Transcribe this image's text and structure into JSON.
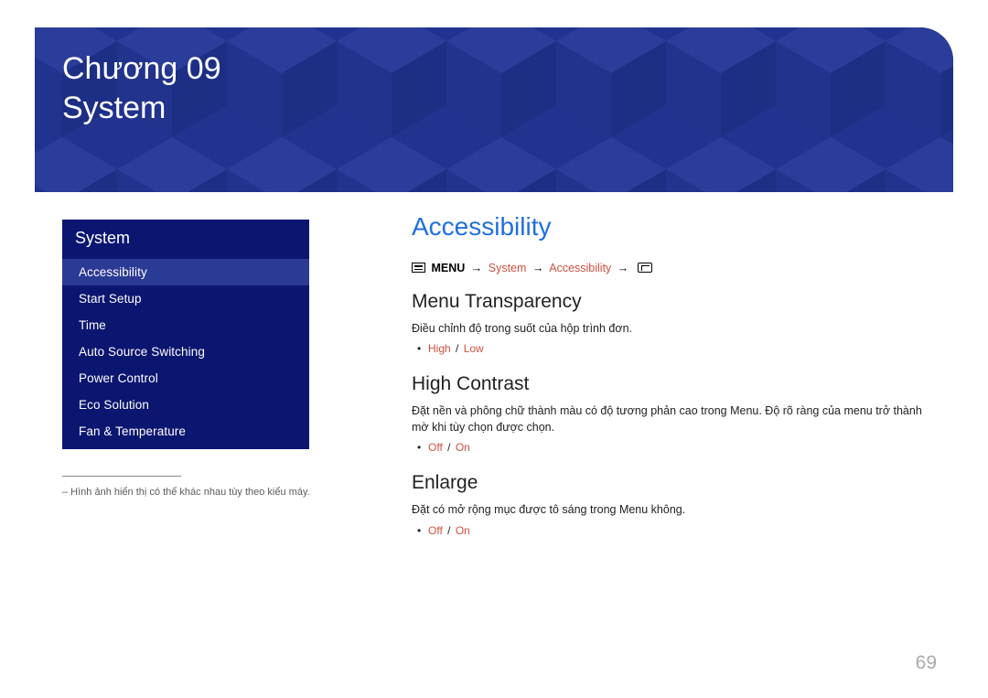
{
  "chapter": {
    "line1": "Chương 09",
    "line2": "System"
  },
  "sidebar": {
    "title": "System",
    "items": [
      {
        "label": "Accessibility",
        "active": true
      },
      {
        "label": "Start Setup",
        "active": false
      },
      {
        "label": "Time",
        "active": false
      },
      {
        "label": "Auto Source Switching",
        "active": false
      },
      {
        "label": "Power Control",
        "active": false
      },
      {
        "label": "Eco Solution",
        "active": false
      },
      {
        "label": "Fan & Temperature",
        "active": false
      }
    ]
  },
  "footnote": "–   Hình ảnh hiển thị có thể khác nhau tùy theo kiểu máy.",
  "main": {
    "title": "Accessibility",
    "path": {
      "menu_word": "MENU",
      "seg1": "System",
      "seg2": "Accessibility"
    },
    "sections": [
      {
        "heading": "Menu Transparency",
        "body": "Điều chỉnh độ trong suốt của hộp trình đơn.",
        "options": [
          "High",
          "Low"
        ]
      },
      {
        "heading": "High Contrast",
        "body": "Đặt nền và phông chữ thành màu có độ tương phản cao trong Menu. Độ rõ ràng của menu trở thành mờ khi tùy chọn được chọn.",
        "options": [
          "Off",
          "On"
        ]
      },
      {
        "heading": "Enlarge",
        "body": "Đặt có mở rộng mục được tô sáng trong Menu không.",
        "options": [
          "Off",
          "On"
        ]
      }
    ]
  },
  "page_number": "69"
}
